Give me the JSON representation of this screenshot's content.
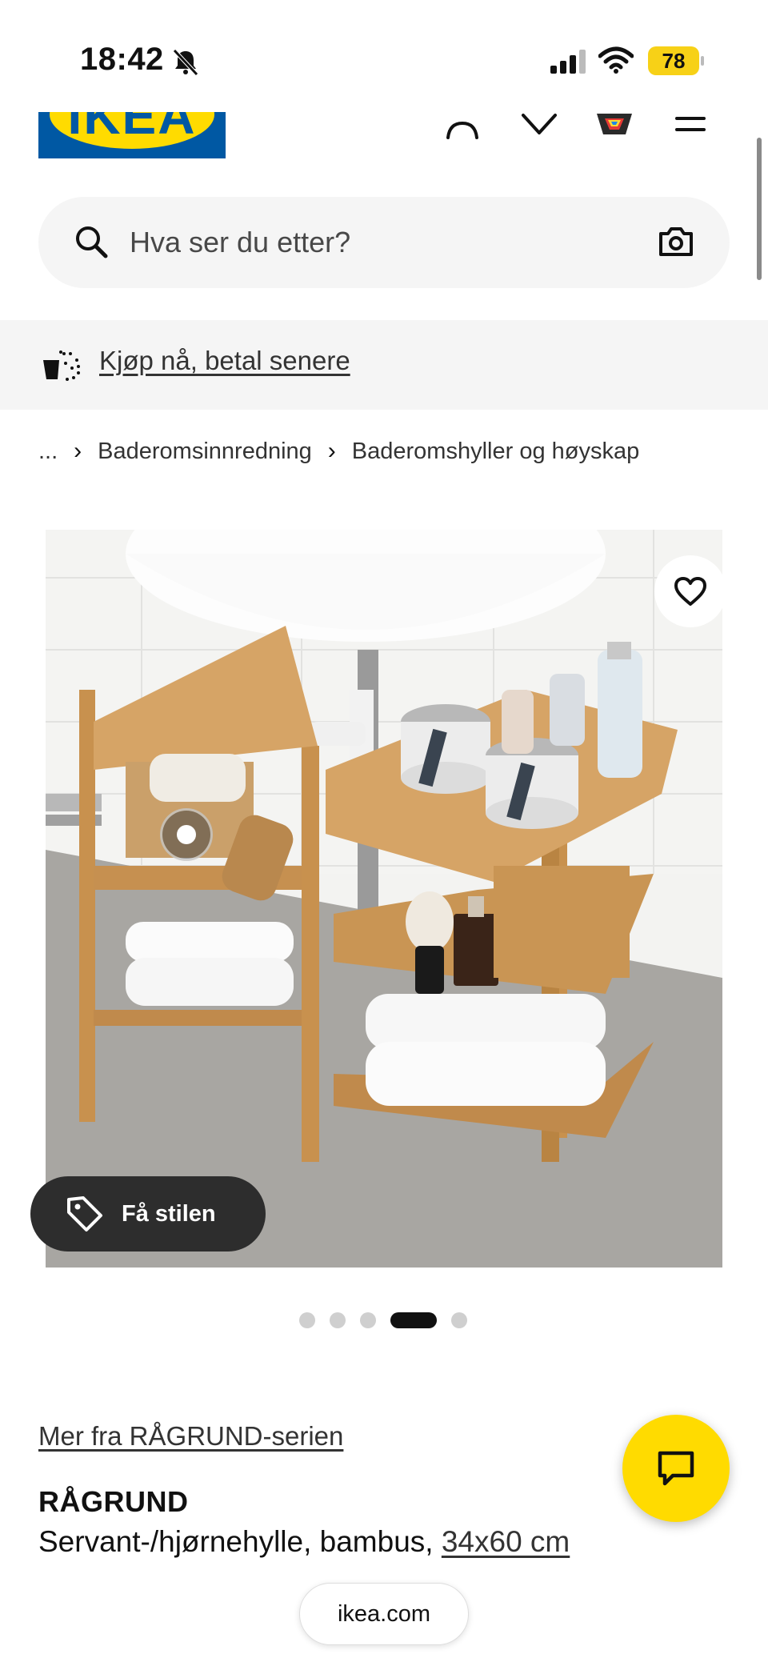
{
  "status_bar": {
    "time": "18:42",
    "battery": "78",
    "battery_color": "#f7d117"
  },
  "header": {
    "logo_text": "IKEA",
    "brand_blue": "#0058a3",
    "brand_yellow": "#ffdb00",
    "icons": [
      "account-icon",
      "favorites-icon",
      "cart-icon",
      "menu-icon"
    ]
  },
  "search": {
    "placeholder": "Hva ser du etter?"
  },
  "promo": {
    "link": "Kjøp nå, betal senere"
  },
  "breadcrumb": {
    "items": [
      "...",
      "Baderomsinnredning",
      "Baderomshyller og høyskap"
    ]
  },
  "gallery": {
    "style_button": "Få stilen",
    "dot_count": 5,
    "active_dot": 4
  },
  "product": {
    "series_link": "Mer fra RÅGRUND-serien",
    "name": "RÅGRUND",
    "description": "Servant-/hjørnehylle, bambus, ",
    "size": "34x60 cm"
  },
  "browser": {
    "url": "ikea.com"
  }
}
